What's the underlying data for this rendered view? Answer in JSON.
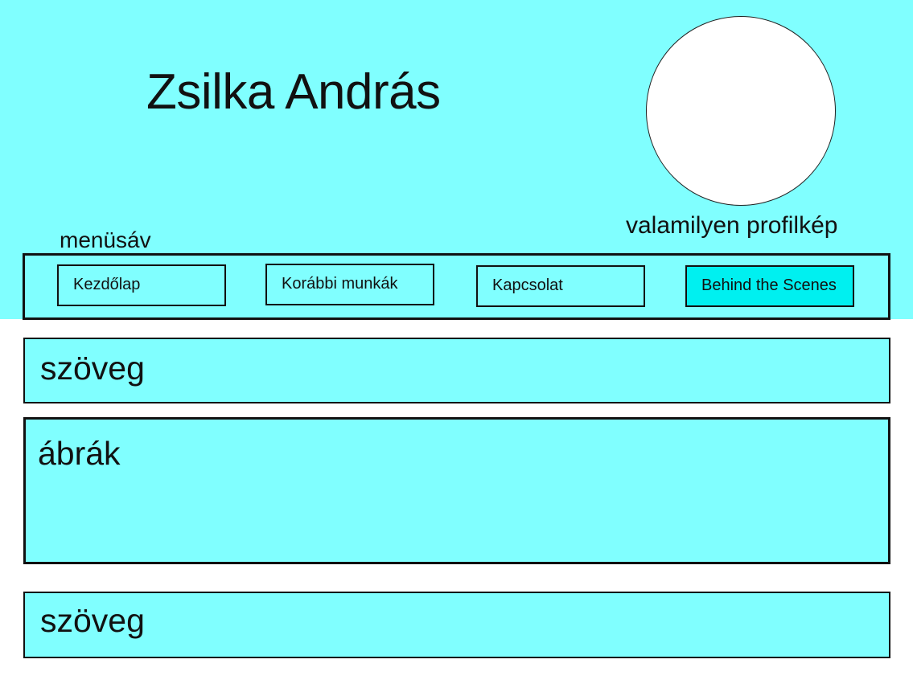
{
  "header": {
    "title": "Zsilka András",
    "profile_label": "valamilyen profilkép",
    "menu_label": "menüsáv"
  },
  "menu": {
    "items": [
      {
        "label": "Kezdőlap"
      },
      {
        "label": "Korábbi munkák"
      },
      {
        "label": "Kapcsolat"
      },
      {
        "label": "Behind the Scenes",
        "active": true
      }
    ]
  },
  "sections": [
    {
      "label": "szöveg"
    },
    {
      "label": "ábrák"
    },
    {
      "label": "szöveg"
    }
  ],
  "colors": {
    "background": "#80ffff",
    "active_item": "#00f0f0",
    "border": "#111111"
  }
}
